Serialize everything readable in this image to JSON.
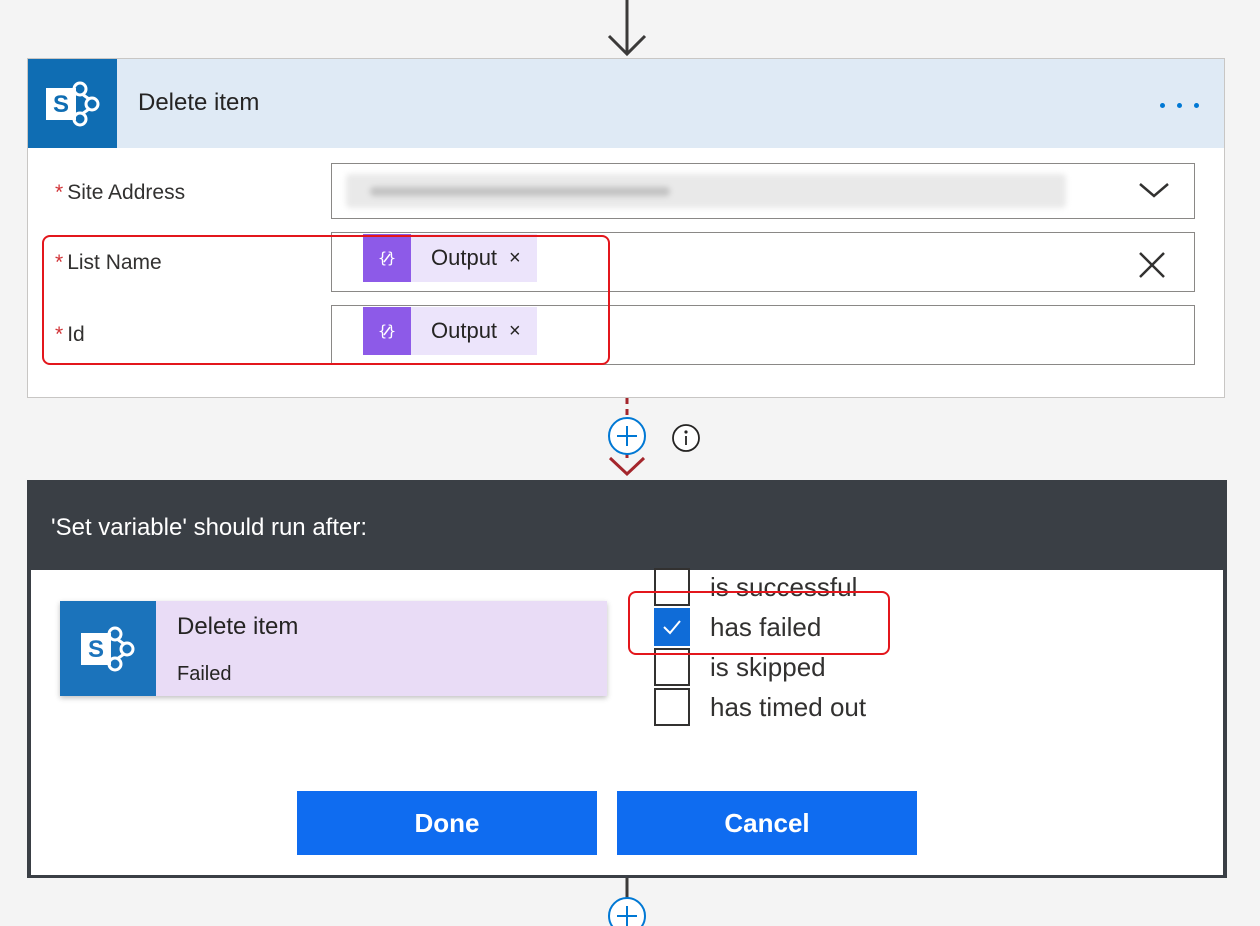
{
  "delete_card": {
    "title": "Delete item",
    "fields": {
      "site_address": {
        "label": "Site Address",
        "required_mark": "*"
      },
      "list_name": {
        "label": "List Name",
        "required_mark": "*",
        "token": "Output"
      },
      "id": {
        "label": "Id",
        "required_mark": "*",
        "token": "Output"
      }
    },
    "token_remove_symbol": "×"
  },
  "run_after": {
    "title": "'Set variable' should run after:",
    "action": {
      "title": "Delete item",
      "status": "Failed"
    },
    "options": [
      {
        "label": "is successful",
        "checked": false
      },
      {
        "label": "has failed",
        "checked": true
      },
      {
        "label": "is skipped",
        "checked": false
      },
      {
        "label": "has timed out",
        "checked": false
      }
    ],
    "done_label": "Done",
    "cancel_label": "Cancel"
  },
  "colors": {
    "sharepoint_tile": "#0f6db3",
    "card_header": "#dfeaf5",
    "token_icon": "#8d5ae8",
    "token_bg": "#ece4fb",
    "panel_header": "#3a3f45",
    "primary_button": "#0f6cf0",
    "highlight_outline": "#e3161c",
    "failed_connector": "#a4262c"
  },
  "icons": [
    "sharepoint-icon",
    "more-options-icon",
    "chevron-down-icon",
    "expression-token-icon",
    "close-icon",
    "add-step-icon",
    "info-icon",
    "checkmark-icon",
    "down-arrow-icon"
  ]
}
